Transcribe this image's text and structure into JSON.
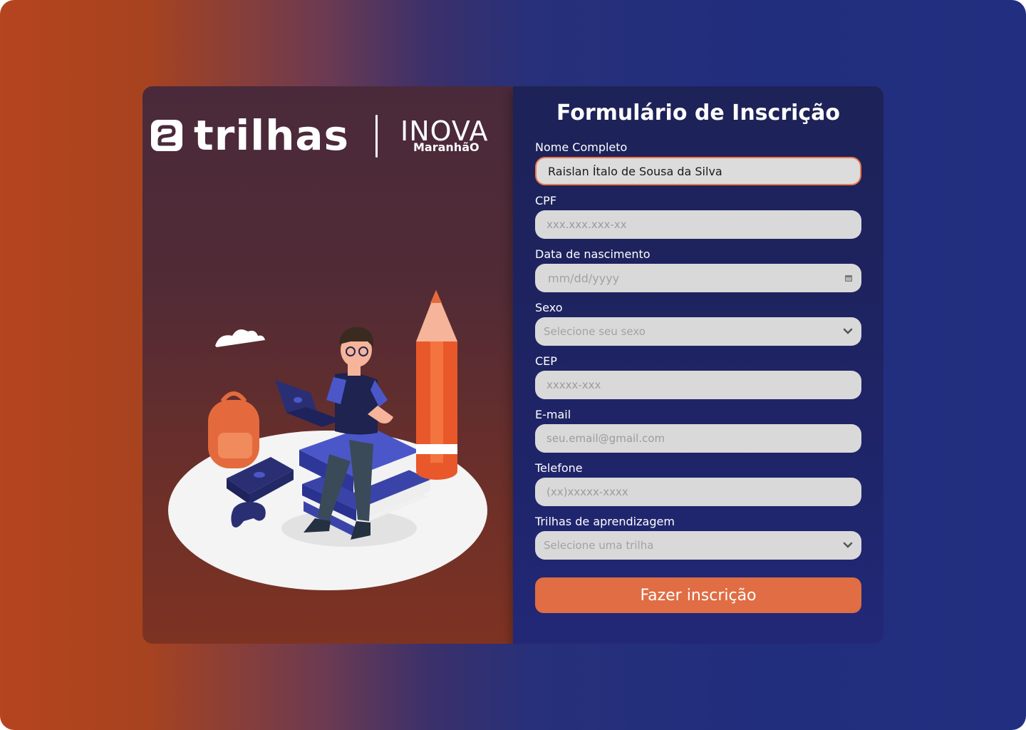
{
  "brand": {
    "trilhas_label": "trilhas",
    "inova_label": "INOVA",
    "inova_sub_label": "MaranhãO"
  },
  "form": {
    "title": "Formulário de Inscrição",
    "fields": {
      "nome": {
        "label": "Nome Completo",
        "value": "Raislan Ítalo de Sousa da Silva"
      },
      "cpf": {
        "label": "CPF",
        "placeholder": "xxx.xxx.xxx-xx"
      },
      "nascimento": {
        "label": "Data de nascimento",
        "placeholder": "mm/dd/yyyy"
      },
      "sexo": {
        "label": "Sexo",
        "placeholder": "Selecione seu sexo"
      },
      "cep": {
        "label": "CEP",
        "placeholder": "xxxxx-xxx"
      },
      "email": {
        "label": "E-mail",
        "placeholder": "seu.email@gmail.com"
      },
      "telefone": {
        "label": "Telefone",
        "placeholder": "(xx)xxxxx-xxxx"
      },
      "trilhas": {
        "label": "Trilhas de aprendizagem",
        "placeholder": "Selecione uma trilha"
      }
    },
    "submit_label": "Fazer inscrição"
  },
  "colors": {
    "accent": "#e06d43",
    "focus_border": "#ef7747",
    "panel_dark_blue": "#1e2466",
    "field_bg": "#d9d9d9"
  },
  "icons": [
    "trilhas-logo-icon",
    "calendar-icon",
    "chevron-down-icon",
    "student-illustration"
  ]
}
